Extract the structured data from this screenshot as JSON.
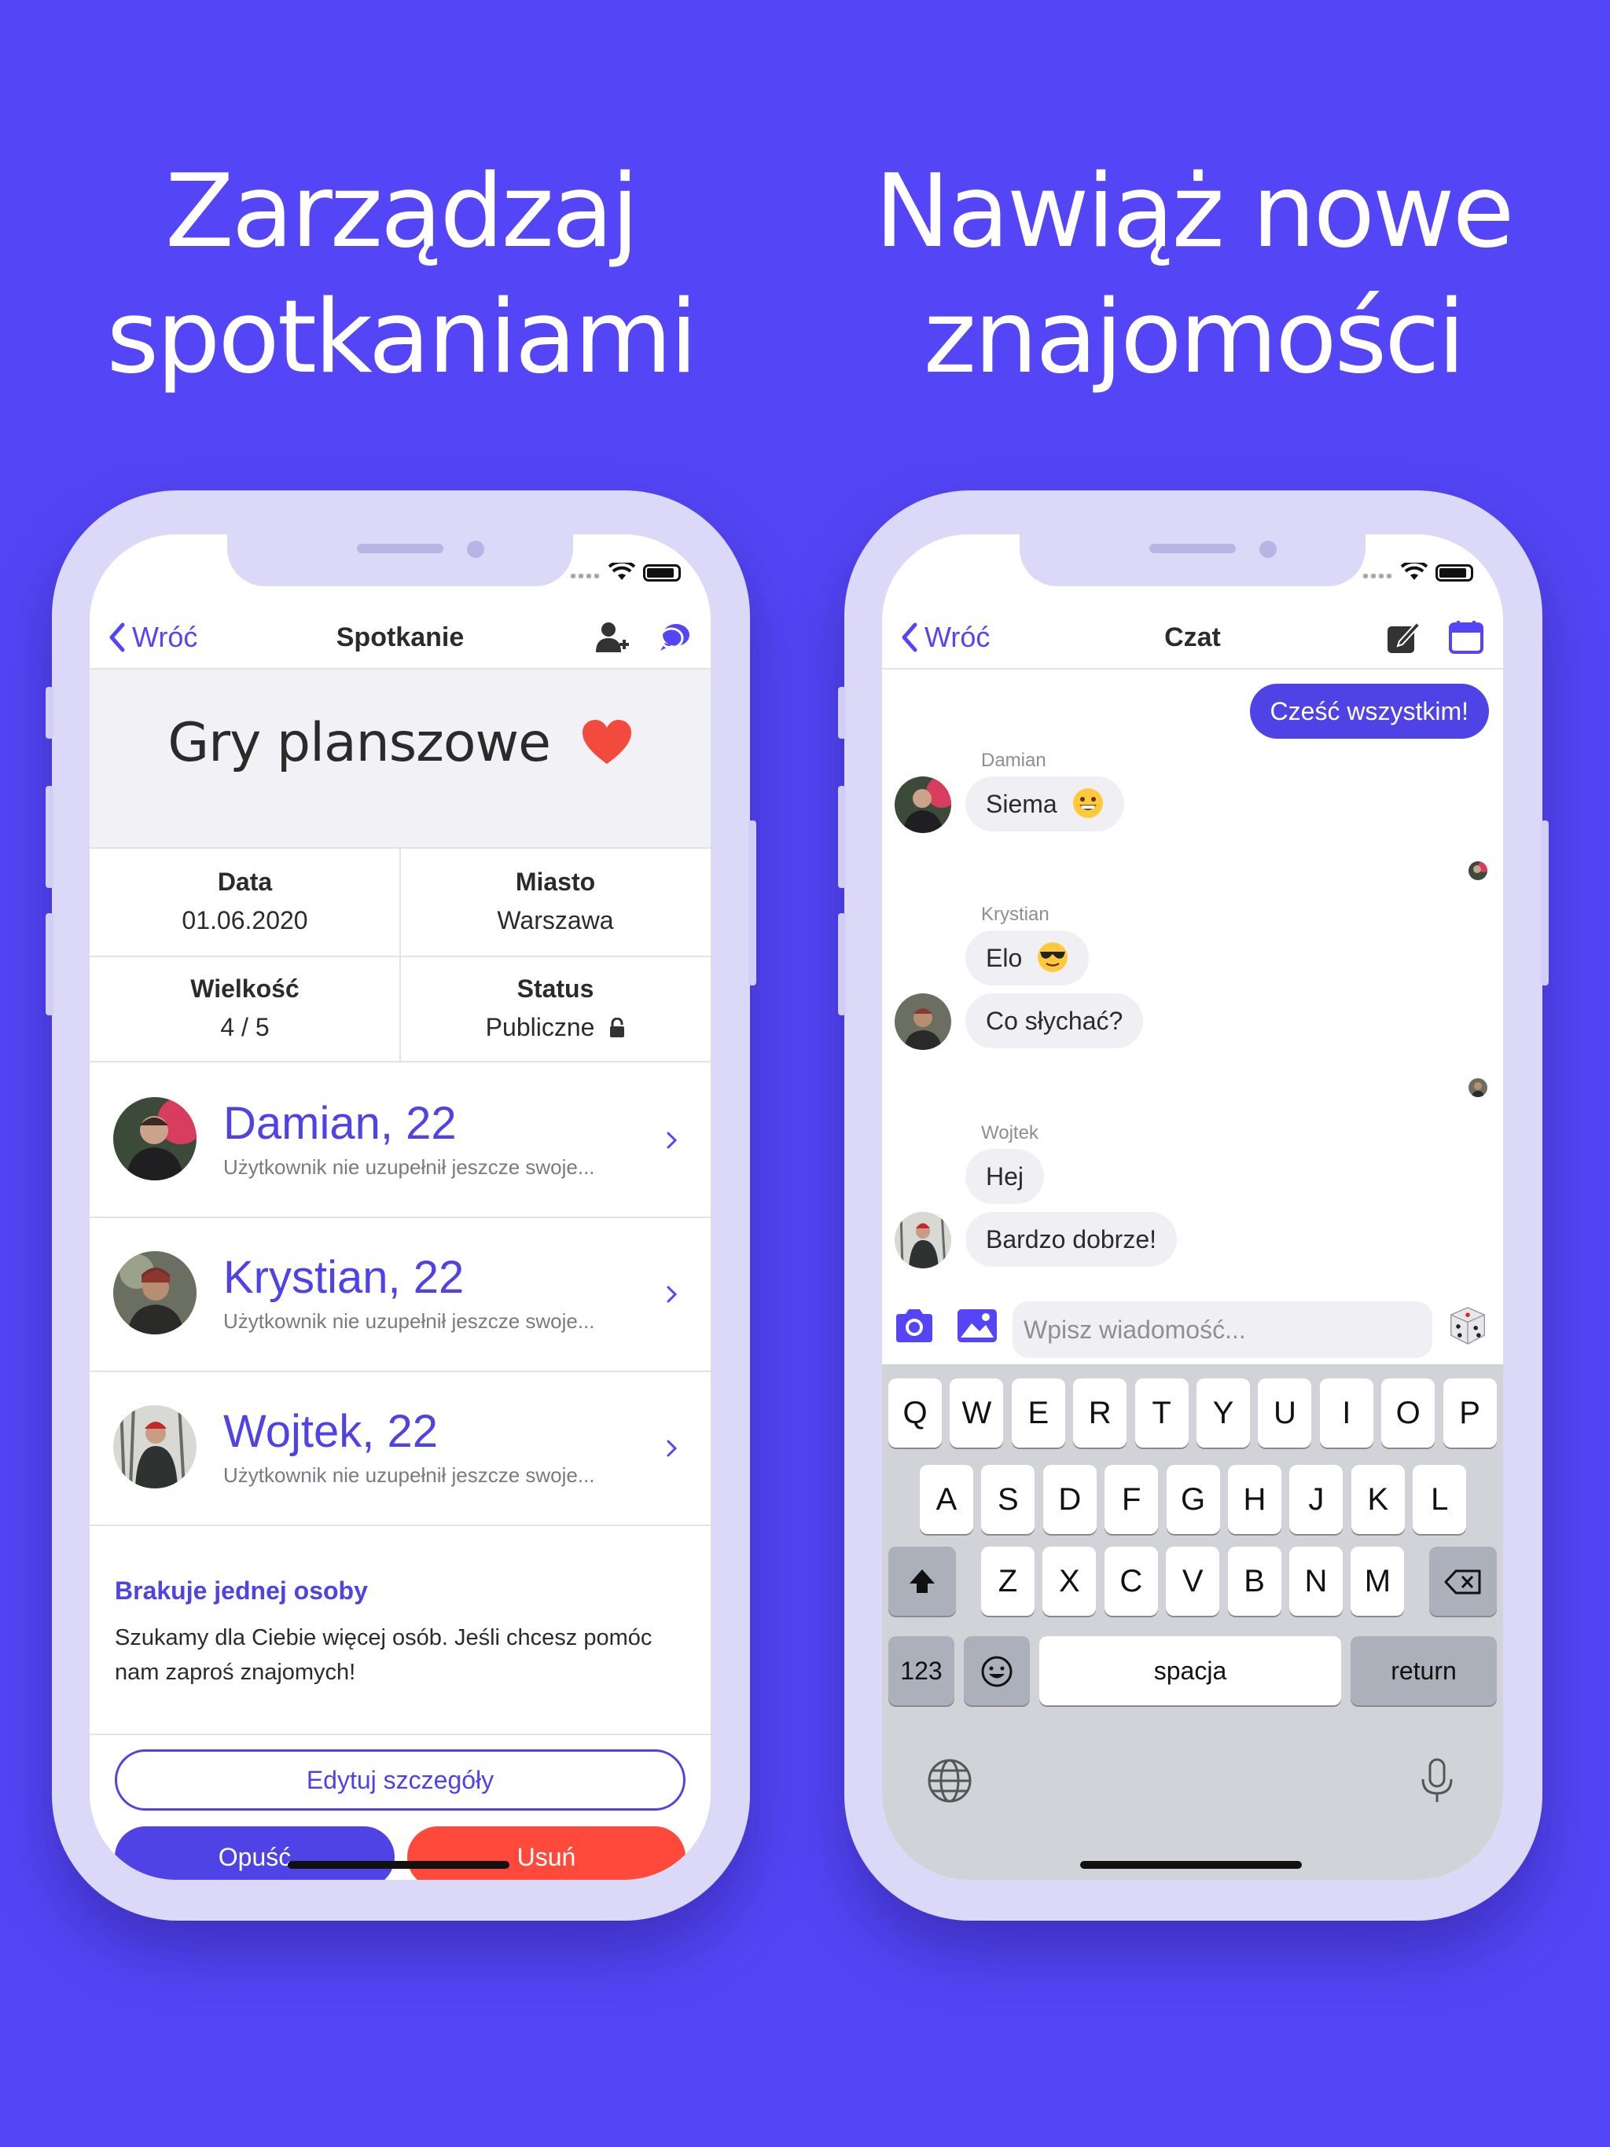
{
  "headlines": {
    "left": [
      "Zarządzaj",
      "spotkaniami"
    ],
    "right": [
      "Nawiąż nowe",
      "znajomości"
    ]
  },
  "colors": {
    "background": "#5446F6",
    "accent": "#4F43E6",
    "danger": "#FF4A3B",
    "frame": "#DCD8F8"
  },
  "meeting_screen": {
    "nav": {
      "back_label": "Wróć",
      "title": "Spotkanie",
      "icons": [
        "add-person-icon",
        "chat-bubbles-icon"
      ]
    },
    "event_title": "Gry planszowe",
    "event_icon": "heart-icon",
    "info": [
      {
        "label": "Data",
        "value": "01.06.2020"
      },
      {
        "label": "Miasto",
        "value": "Warszawa"
      },
      {
        "label": "Wielkość",
        "value": "4 / 5"
      },
      {
        "label": "Status",
        "value": "Publiczne",
        "icon": "lock-icon"
      }
    ],
    "members": [
      {
        "name": "Damian, 22",
        "description": "Użytkownik nie uzupełnił jeszcze swoje..."
      },
      {
        "name": "Krystian, 22",
        "description": "Użytkownik nie uzupełnił jeszcze swoje..."
      },
      {
        "name": "Wojtek, 22",
        "description": "Użytkownik nie uzupełnił jeszcze swoje..."
      }
    ],
    "missing": {
      "title": "Brakuje jednej osoby",
      "text": "Szukamy dla Ciebie więcej osób. Jeśli chcesz pomóc nam zaproś znajomych!"
    },
    "buttons": {
      "edit": "Edytuj szczegóły",
      "leave": "Opuść",
      "remove": "Usuń"
    }
  },
  "chat_screen": {
    "nav": {
      "back_label": "Wróć",
      "title": "Czat",
      "icons": [
        "compose-icon",
        "calendar-icon"
      ]
    },
    "outgoing": "Cześć wszystkim!",
    "groups": [
      {
        "sender": "Damian",
        "messages": [
          "Siema"
        ],
        "emoji": "grinning-emoji"
      },
      {
        "sender": "Krystian",
        "messages": [
          "Elo",
          "Co słychać?"
        ],
        "emoji": "sunglasses-emoji"
      },
      {
        "sender": "Wojtek",
        "messages": [
          "Hej",
          "Bardzo dobrze!"
        ]
      }
    ],
    "composer": {
      "placeholder": "Wpisz wiadomość...",
      "icons": [
        "camera-icon",
        "image-icon",
        "dice-icon"
      ]
    },
    "keyboard": {
      "row1": [
        "Q",
        "W",
        "E",
        "R",
        "T",
        "Y",
        "U",
        "I",
        "O",
        "P"
      ],
      "row2": [
        "A",
        "S",
        "D",
        "F",
        "G",
        "H",
        "J",
        "K",
        "L"
      ],
      "row3": [
        "Z",
        "X",
        "C",
        "V",
        "B",
        "N",
        "M"
      ],
      "numbers": "123",
      "space": "spacja",
      "return": "return"
    }
  }
}
